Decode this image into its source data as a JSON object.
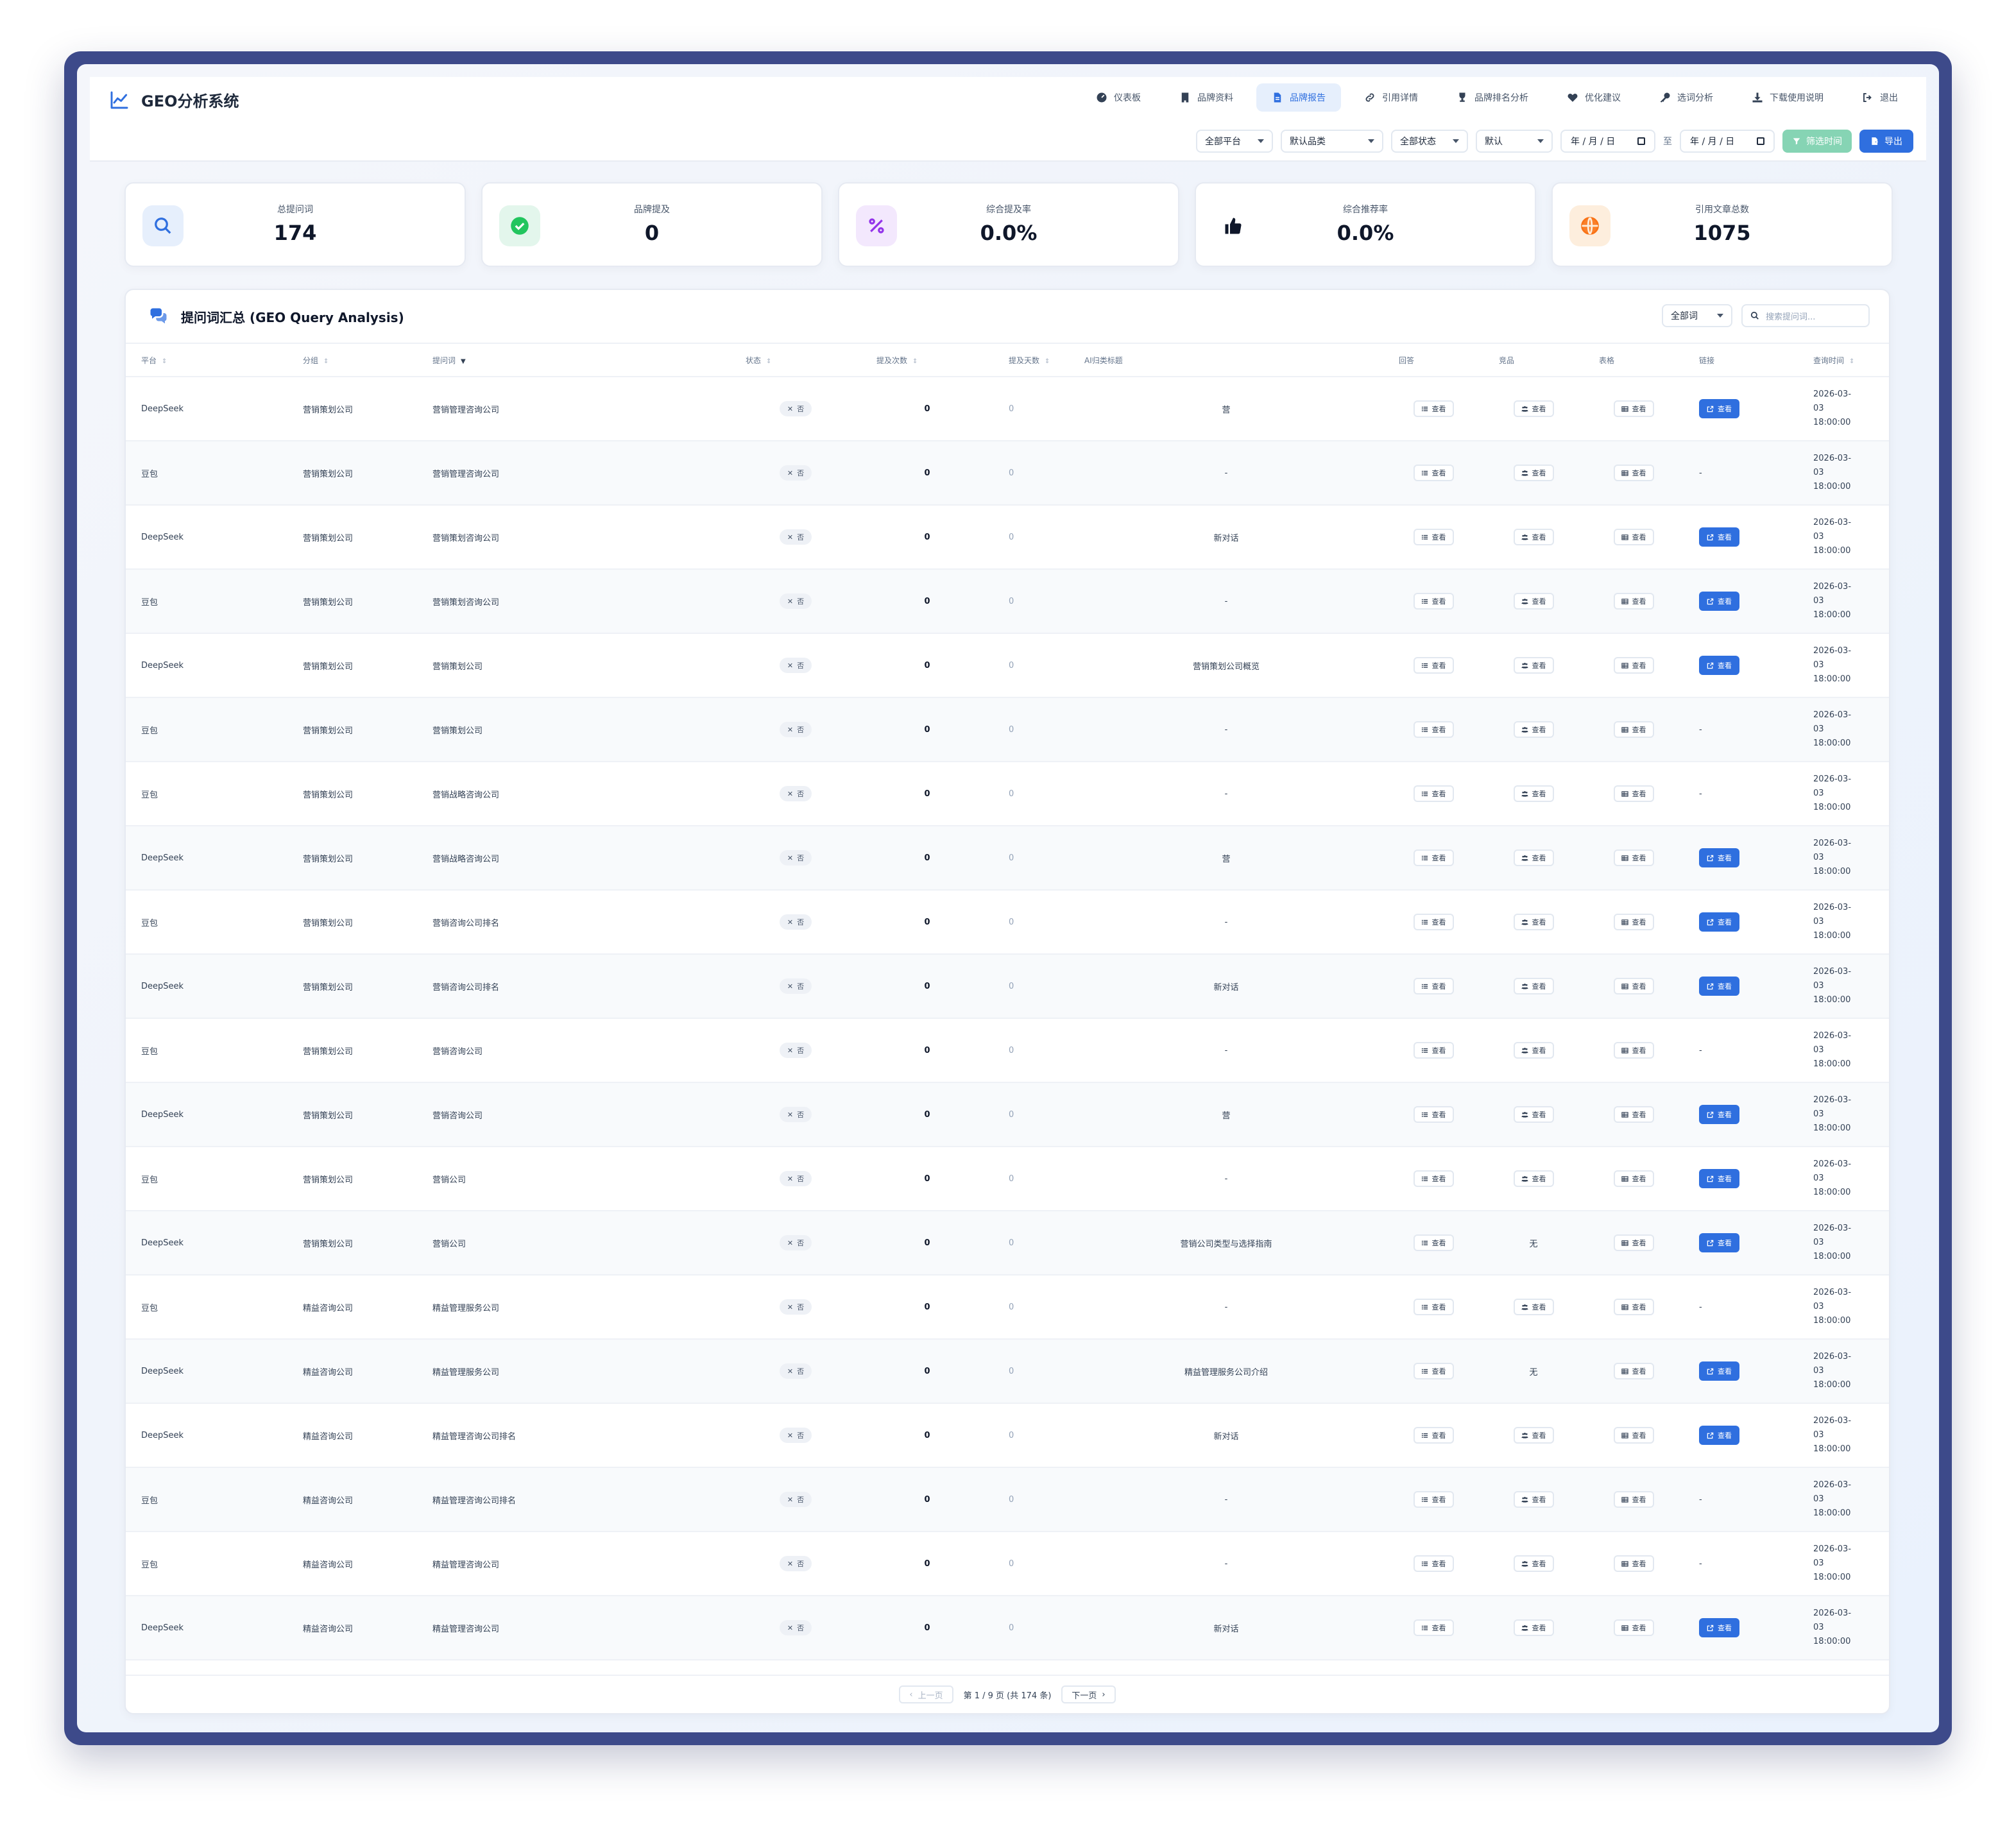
{
  "app": {
    "title": "GEO分析系统",
    "accent": "#2f6fdf"
  },
  "nav": [
    {
      "label": "仪表板",
      "icon": "dashboard-icon",
      "active": false
    },
    {
      "label": "品牌资料",
      "icon": "building-icon",
      "active": false
    },
    {
      "label": "品牌报告",
      "icon": "file-icon",
      "active": true
    },
    {
      "label": "引用详情",
      "icon": "link-icon",
      "active": false
    },
    {
      "label": "品牌排名分析",
      "icon": "trophy-icon",
      "active": false
    },
    {
      "label": "优化建议",
      "icon": "heart-icon",
      "active": false
    },
    {
      "label": "选词分析",
      "icon": "key-icon",
      "active": false
    },
    {
      "label": "下载使用说明",
      "icon": "download-icon",
      "active": false
    },
    {
      "label": "退出",
      "icon": "logout-icon",
      "active": false
    }
  ],
  "filters": {
    "platform": "全部平台",
    "category": "默认品类",
    "status": "全部状态",
    "sort": "默认",
    "date_from": "年 / 月 / 日",
    "date_sep": "至",
    "date_to": "年 / 月 / 日",
    "filter_button": "筛选时间",
    "export_button": "导出"
  },
  "stats": [
    {
      "label": "总提问词",
      "value": "174",
      "icon": "search-icon",
      "bg": "#e6effc",
      "fg": "#2f6fdf"
    },
    {
      "label": "品牌提及",
      "value": "0",
      "icon": "check-circle-icon",
      "bg": "#e3f6ec",
      "fg": "#22c55e"
    },
    {
      "label": "综合提及率",
      "value": "0.0%",
      "icon": "percent-icon",
      "bg": "#f3e8fd",
      "fg": "#9333ea"
    },
    {
      "label": "综合推荐率",
      "value": "0.0%",
      "icon": "thumbs-up-icon",
      "bg": "#ffffff",
      "fg": "#0f172a"
    },
    {
      "label": "引用文章总数",
      "value": "1075",
      "icon": "globe-icon",
      "bg": "#fdeedd",
      "fg": "#f97316"
    }
  ],
  "table": {
    "title": "提问词汇总 (GEO Query Analysis)",
    "scope": "全部词",
    "search_placeholder": "搜索提问词...",
    "columns": {
      "platform": "平台",
      "group": "分组",
      "query": "提问词",
      "status": "状态",
      "mentions": "提及次数",
      "days": "提及天数",
      "ai_title": "AI归类标题",
      "answer": "回答",
      "competitors": "竞品",
      "sheet": "表格",
      "link": "链接",
      "time": "查询时间"
    },
    "status_label": "否",
    "view_label": "查看",
    "none_label": "无",
    "dash": "-",
    "rows": [
      {
        "platform": "DeepSeek",
        "group": "营销策划公司",
        "query": "营销管理咨询公司",
        "mentions": "0",
        "days": "0",
        "ai_title": "营",
        "competitors": "view",
        "link": true,
        "time": "2026-03-03 18:00:00"
      },
      {
        "platform": "豆包",
        "group": "营销策划公司",
        "query": "营销管理咨询公司",
        "mentions": "0",
        "days": "0",
        "ai_title": "-",
        "competitors": "view",
        "link": false,
        "time": "2026-03-03 18:00:00"
      },
      {
        "platform": "DeepSeek",
        "group": "营销策划公司",
        "query": "营销策划咨询公司",
        "mentions": "0",
        "days": "0",
        "ai_title": "新对话",
        "competitors": "view",
        "link": true,
        "time": "2026-03-03 18:00:00"
      },
      {
        "platform": "豆包",
        "group": "营销策划公司",
        "query": "营销策划咨询公司",
        "mentions": "0",
        "days": "0",
        "ai_title": "-",
        "competitors": "view",
        "link": true,
        "time": "2026-03-03 18:00:00"
      },
      {
        "platform": "DeepSeek",
        "group": "营销策划公司",
        "query": "营销策划公司",
        "mentions": "0",
        "days": "0",
        "ai_title": "营销策划公司概览",
        "competitors": "view",
        "link": true,
        "time": "2026-03-03 18:00:00"
      },
      {
        "platform": "豆包",
        "group": "营销策划公司",
        "query": "营销策划公司",
        "mentions": "0",
        "days": "0",
        "ai_title": "-",
        "competitors": "view",
        "link": false,
        "time": "2026-03-03 18:00:00"
      },
      {
        "platform": "豆包",
        "group": "营销策划公司",
        "query": "营销战略咨询公司",
        "mentions": "0",
        "days": "0",
        "ai_title": "-",
        "competitors": "view",
        "link": false,
        "time": "2026-03-03 18:00:00"
      },
      {
        "platform": "DeepSeek",
        "group": "营销策划公司",
        "query": "营销战略咨询公司",
        "mentions": "0",
        "days": "0",
        "ai_title": "营",
        "competitors": "view",
        "link": true,
        "time": "2026-03-03 18:00:00"
      },
      {
        "platform": "豆包",
        "group": "营销策划公司",
        "query": "营销咨询公司排名",
        "mentions": "0",
        "days": "0",
        "ai_title": "-",
        "competitors": "view",
        "link": true,
        "time": "2026-03-03 18:00:00"
      },
      {
        "platform": "DeepSeek",
        "group": "营销策划公司",
        "query": "营销咨询公司排名",
        "mentions": "0",
        "days": "0",
        "ai_title": "新对话",
        "competitors": "view",
        "link": true,
        "time": "2026-03-03 18:00:00"
      },
      {
        "platform": "豆包",
        "group": "营销策划公司",
        "query": "营销咨询公司",
        "mentions": "0",
        "days": "0",
        "ai_title": "-",
        "competitors": "view",
        "link": false,
        "time": "2026-03-03 18:00:00"
      },
      {
        "platform": "DeepSeek",
        "group": "营销策划公司",
        "query": "营销咨询公司",
        "mentions": "0",
        "days": "0",
        "ai_title": "营",
        "competitors": "view",
        "link": true,
        "time": "2026-03-03 18:00:00"
      },
      {
        "platform": "豆包",
        "group": "营销策划公司",
        "query": "营销公司",
        "mentions": "0",
        "days": "0",
        "ai_title": "-",
        "competitors": "view",
        "link": true,
        "time": "2026-03-03 18:00:00"
      },
      {
        "platform": "DeepSeek",
        "group": "营销策划公司",
        "query": "营销公司",
        "mentions": "0",
        "days": "0",
        "ai_title": "营销公司类型与选择指南",
        "competitors": "none",
        "link": true,
        "time": "2026-03-03 18:00:00"
      },
      {
        "platform": "豆包",
        "group": "精益咨询公司",
        "query": "精益管理服务公司",
        "mentions": "0",
        "days": "0",
        "ai_title": "-",
        "competitors": "view",
        "link": false,
        "time": "2026-03-03 18:00:00"
      },
      {
        "platform": "DeepSeek",
        "group": "精益咨询公司",
        "query": "精益管理服务公司",
        "mentions": "0",
        "days": "0",
        "ai_title": "精益管理服务公司介绍",
        "competitors": "none",
        "link": true,
        "time": "2026-03-03 18:00:00"
      },
      {
        "platform": "DeepSeek",
        "group": "精益咨询公司",
        "query": "精益管理咨询公司排名",
        "mentions": "0",
        "days": "0",
        "ai_title": "新对话",
        "competitors": "view",
        "link": true,
        "time": "2026-03-03 18:00:00"
      },
      {
        "platform": "豆包",
        "group": "精益咨询公司",
        "query": "精益管理咨询公司排名",
        "mentions": "0",
        "days": "0",
        "ai_title": "-",
        "competitors": "view",
        "link": false,
        "time": "2026-03-03 18:00:00"
      },
      {
        "platform": "豆包",
        "group": "精益咨询公司",
        "query": "精益管理咨询公司",
        "mentions": "0",
        "days": "0",
        "ai_title": "-",
        "competitors": "view",
        "link": false,
        "time": "2026-03-03 18:00:00"
      },
      {
        "platform": "DeepSeek",
        "group": "精益咨询公司",
        "query": "精益管理咨询公司",
        "mentions": "0",
        "days": "0",
        "ai_title": "新对话",
        "competitors": "view",
        "link": true,
        "time": "2026-03-03 18:00:00"
      }
    ]
  },
  "pager": {
    "prev": "上一页",
    "info": "第 1 / 9 页 (共 174 条)",
    "next": "下一页"
  }
}
